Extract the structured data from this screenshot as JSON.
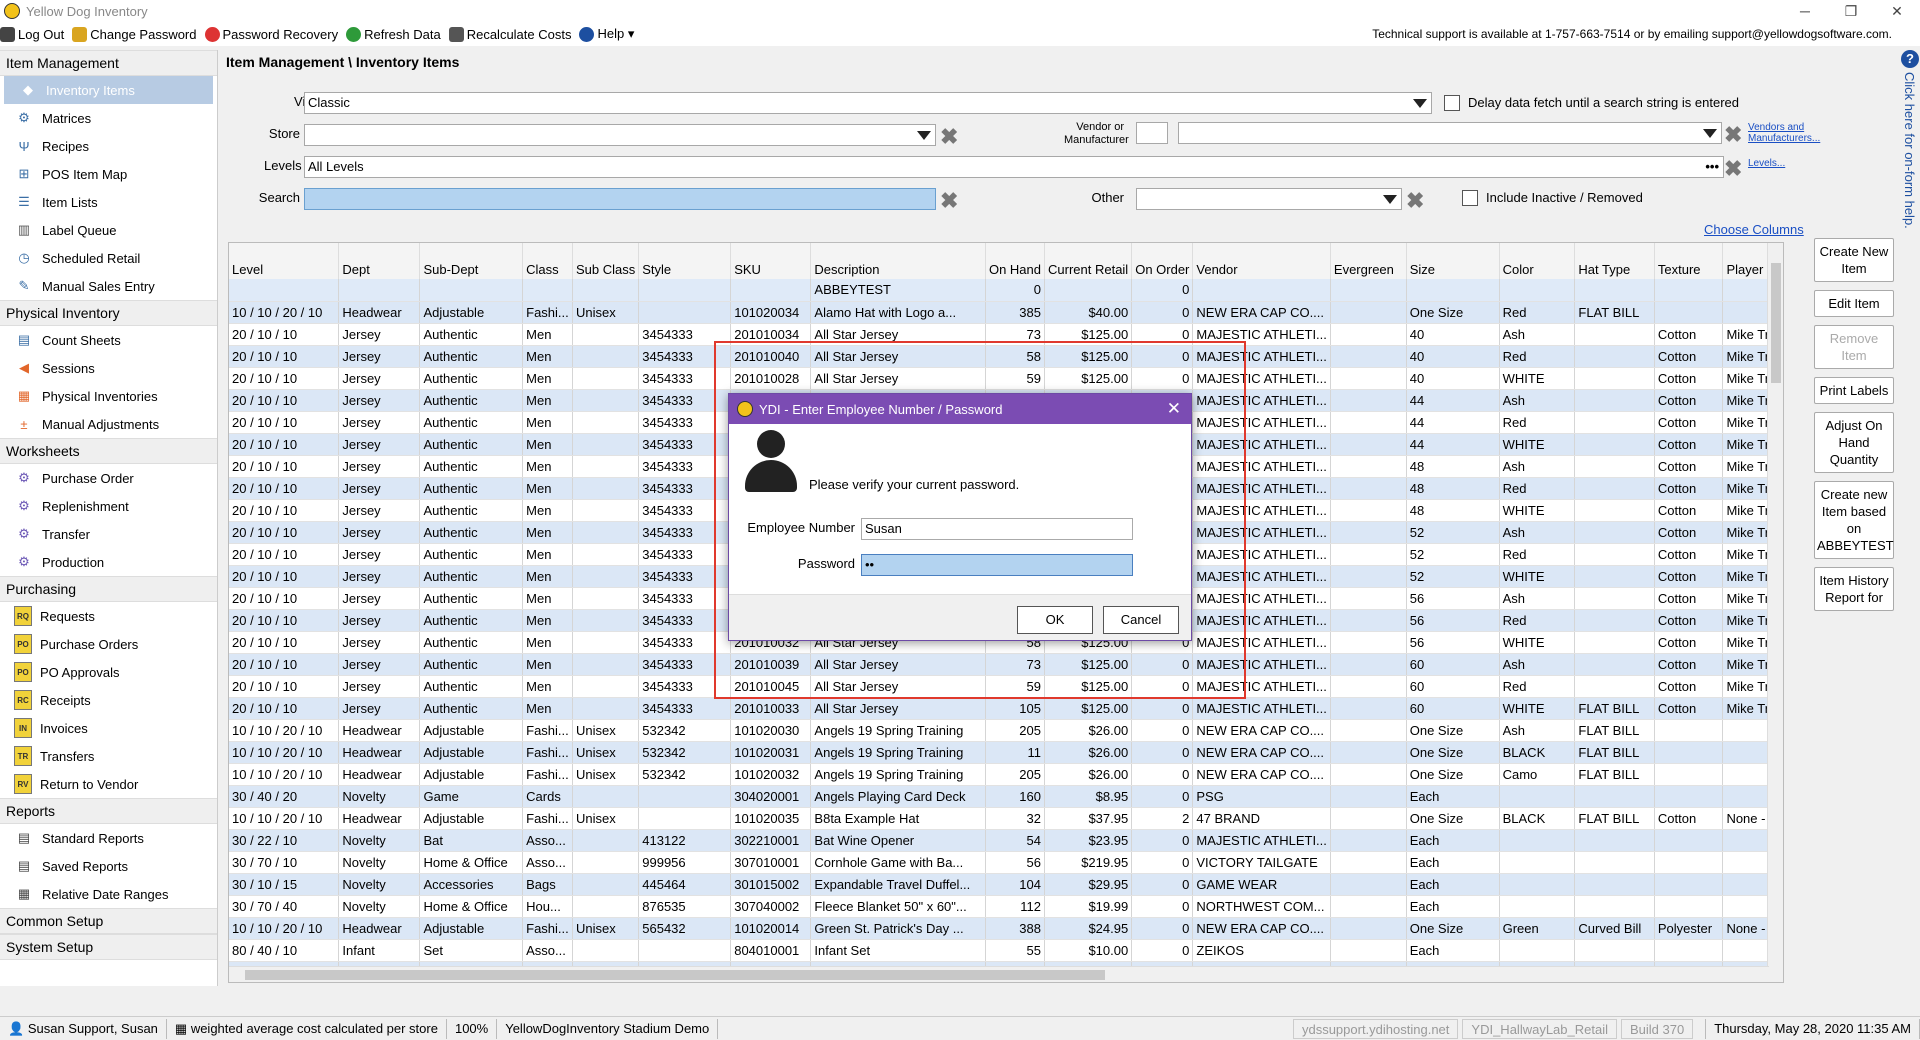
{
  "window": {
    "title": "Yellow Dog Inventory"
  },
  "menubar": {
    "items": [
      "Log Out",
      "Change Password",
      "Password Recovery",
      "Refresh Data",
      "Recalculate Costs",
      "Help ▾"
    ],
    "support": "Technical support is available at 1-757-663-7514 or by emailing support@yellowdogsoftware.com."
  },
  "sidebar": {
    "sections": [
      {
        "label": "Item Management",
        "items": [
          "Inventory Items",
          "Matrices",
          "Recipes",
          "POS Item Map",
          "Item Lists",
          "Label Queue",
          "Scheduled Retail",
          "Manual Sales Entry"
        ]
      },
      {
        "label": "Physical Inventory",
        "items": [
          "Count Sheets",
          "Sessions",
          "Physical Inventories",
          "Manual Adjustments"
        ]
      },
      {
        "label": "Worksheets",
        "items": [
          "Purchase Order",
          "Replenishment",
          "Transfer",
          "Production"
        ]
      },
      {
        "label": "Purchasing",
        "items": [
          "Requests",
          "Purchase Orders",
          "PO Approvals",
          "Receipts",
          "Invoices",
          "Transfers",
          "Return to Vendor"
        ]
      },
      {
        "label": "Reports",
        "items": [
          "Standard Reports",
          "Saved Reports",
          "Relative Date Ranges"
        ]
      },
      {
        "label": "Common Setup",
        "items": []
      },
      {
        "label": "System Setup",
        "items": []
      }
    ],
    "doc_badges": [
      "RQ",
      "PO",
      "PO",
      "RC",
      "IN",
      "TR",
      "RV"
    ]
  },
  "breadcrumb": "Item Management \\ Inventory Items",
  "filters": {
    "view_label": "View",
    "view_value": "Classic",
    "delay_label": "Delay data fetch until a search string is entered",
    "store_label": "Store",
    "store_value": "",
    "vendor_label": "Vendor or Manufacturer",
    "vendors_link": "Vendors and Manufacturers...",
    "levels_label": "Levels",
    "levels_value": "All Levels",
    "levels_dots": "•••",
    "levels_link": "Levels...",
    "search_label": "Search",
    "search_value": "",
    "other_label": "Other",
    "include_inactive_label": "Include Inactive / Removed"
  },
  "choose_columns": "Choose Columns",
  "grid": {
    "columns": [
      "Level",
      "Dept",
      "Sub-Dept",
      "Class",
      "Sub Class",
      "Style",
      "SKU",
      "Description",
      "On Hand",
      "Current Retail",
      "On Order",
      "Vendor",
      "Evergreen",
      "Size",
      "Color",
      "Hat Type",
      "Texture",
      "Player"
    ],
    "rows": [
      [
        "",
        "",
        "",
        "",
        "",
        "",
        "",
        "ABBEYTEST",
        "0",
        "",
        "0",
        "",
        "",
        "",
        "",
        "",
        "",
        ""
      ],
      [
        "10 / 10 / 20 / 10",
        "Headwear",
        "Adjustable",
        "Fashi...",
        "Unisex",
        "",
        "101020034",
        "Alamo Hat with Logo a...",
        "385",
        "$40.00",
        "0",
        "NEW ERA CAP CO....",
        "",
        "One Size",
        "Red",
        "FLAT BILL",
        "",
        ""
      ],
      [
        "20 / 10 / 10",
        "Jersey",
        "Authentic",
        "Men",
        "",
        "3454333",
        "201010034",
        "All Star Jersey",
        "73",
        "$125.00",
        "0",
        "MAJESTIC ATHLETI...",
        "",
        "40",
        "Ash",
        "",
        "Cotton",
        "Mike Tro"
      ],
      [
        "20 / 10 / 10",
        "Jersey",
        "Authentic",
        "Men",
        "",
        "3454333",
        "201010040",
        "All Star Jersey",
        "58",
        "$125.00",
        "0",
        "MAJESTIC ATHLETI...",
        "",
        "40",
        "Red",
        "",
        "Cotton",
        "Mike Tro"
      ],
      [
        "20 / 10 / 10",
        "Jersey",
        "Authentic",
        "Men",
        "",
        "3454333",
        "201010028",
        "All Star Jersey",
        "59",
        "$125.00",
        "0",
        "MAJESTIC ATHLETI...",
        "",
        "40",
        "WHITE",
        "",
        "Cotton",
        "Mike Tro"
      ],
      [
        "20 / 10 / 10",
        "Jersey",
        "Authentic",
        "Men",
        "",
        "3454333",
        "",
        "",
        "",
        "",
        "",
        "MAJESTIC ATHLETI...",
        "",
        "44",
        "Ash",
        "",
        "Cotton",
        "Mike Tro"
      ],
      [
        "20 / 10 / 10",
        "Jersey",
        "Authentic",
        "Men",
        "",
        "3454333",
        "",
        "",
        "",
        "",
        "",
        "MAJESTIC ATHLETI...",
        "",
        "44",
        "Red",
        "",
        "Cotton",
        "Mike Tro"
      ],
      [
        "20 / 10 / 10",
        "Jersey",
        "Authentic",
        "Men",
        "",
        "3454333",
        "",
        "",
        "",
        "",
        "",
        "MAJESTIC ATHLETI...",
        "",
        "44",
        "WHITE",
        "",
        "Cotton",
        "Mike Tro"
      ],
      [
        "20 / 10 / 10",
        "Jersey",
        "Authentic",
        "Men",
        "",
        "3454333",
        "",
        "",
        "",
        "",
        "",
        "MAJESTIC ATHLETI...",
        "",
        "48",
        "Ash",
        "",
        "Cotton",
        "Mike Tro"
      ],
      [
        "20 / 10 / 10",
        "Jersey",
        "Authentic",
        "Men",
        "",
        "3454333",
        "",
        "",
        "",
        "",
        "",
        "MAJESTIC ATHLETI...",
        "",
        "48",
        "Red",
        "",
        "Cotton",
        "Mike Tro"
      ],
      [
        "20 / 10 / 10",
        "Jersey",
        "Authentic",
        "Men",
        "",
        "3454333",
        "",
        "",
        "",
        "",
        "",
        "MAJESTIC ATHLETI...",
        "",
        "48",
        "WHITE",
        "",
        "Cotton",
        "Mike Tro"
      ],
      [
        "20 / 10 / 10",
        "Jersey",
        "Authentic",
        "Men",
        "",
        "3454333",
        "",
        "",
        "",
        "",
        "",
        "MAJESTIC ATHLETI...",
        "",
        "52",
        "Ash",
        "",
        "Cotton",
        "Mike Tro"
      ],
      [
        "20 / 10 / 10",
        "Jersey",
        "Authentic",
        "Men",
        "",
        "3454333",
        "",
        "",
        "",
        "",
        "",
        "MAJESTIC ATHLETI...",
        "",
        "52",
        "Red",
        "",
        "Cotton",
        "Mike Tro"
      ],
      [
        "20 / 10 / 10",
        "Jersey",
        "Authentic",
        "Men",
        "",
        "3454333",
        "",
        "",
        "",
        "",
        "",
        "MAJESTIC ATHLETI...",
        "",
        "52",
        "WHITE",
        "",
        "Cotton",
        "Mike Tro"
      ],
      [
        "20 / 10 / 10",
        "Jersey",
        "Authentic",
        "Men",
        "",
        "3454333",
        "",
        "",
        "",
        "",
        "",
        "MAJESTIC ATHLETI...",
        "",
        "56",
        "Ash",
        "",
        "Cotton",
        "Mike Tro"
      ],
      [
        "20 / 10 / 10",
        "Jersey",
        "Authentic",
        "Men",
        "",
        "3454333",
        "",
        "",
        "",
        "",
        "",
        "MAJESTIC ATHLETI...",
        "",
        "56",
        "Red",
        "",
        "Cotton",
        "Mike Tro"
      ],
      [
        "20 / 10 / 10",
        "Jersey",
        "Authentic",
        "Men",
        "",
        "3454333",
        "201010032",
        "All Star Jersey",
        "58",
        "$125.00",
        "0",
        "MAJESTIC ATHLETI...",
        "",
        "56",
        "WHITE",
        "",
        "Cotton",
        "Mike Tro"
      ],
      [
        "20 / 10 / 10",
        "Jersey",
        "Authentic",
        "Men",
        "",
        "3454333",
        "201010039",
        "All Star Jersey",
        "73",
        "$125.00",
        "0",
        "MAJESTIC ATHLETI...",
        "",
        "60",
        "Ash",
        "",
        "Cotton",
        "Mike Tro"
      ],
      [
        "20 / 10 / 10",
        "Jersey",
        "Authentic",
        "Men",
        "",
        "3454333",
        "201010045",
        "All Star Jersey",
        "59",
        "$125.00",
        "0",
        "MAJESTIC ATHLETI...",
        "",
        "60",
        "Red",
        "",
        "Cotton",
        "Mike Tro"
      ],
      [
        "20 / 10 / 10",
        "Jersey",
        "Authentic",
        "Men",
        "",
        "3454333",
        "201010033",
        "All Star Jersey",
        "105",
        "$125.00",
        "0",
        "MAJESTIC ATHLETI...",
        "",
        "60",
        "WHITE",
        "FLAT BILL",
        "Cotton",
        "Mike Tro"
      ],
      [
        "10 / 10 / 20 / 10",
        "Headwear",
        "Adjustable",
        "Fashi...",
        "Unisex",
        "532342",
        "101020030",
        "Angels 19 Spring Training",
        "205",
        "$26.00",
        "0",
        "NEW ERA CAP CO....",
        "",
        "One Size",
        "Ash",
        "FLAT BILL",
        "",
        ""
      ],
      [
        "10 / 10 / 20 / 10",
        "Headwear",
        "Adjustable",
        "Fashi...",
        "Unisex",
        "532342",
        "101020031",
        "Angels 19 Spring Training",
        "11",
        "$26.00",
        "0",
        "NEW ERA CAP CO....",
        "",
        "One Size",
        "BLACK",
        "FLAT BILL",
        "",
        ""
      ],
      [
        "10 / 10 / 20 / 10",
        "Headwear",
        "Adjustable",
        "Fashi...",
        "Unisex",
        "532342",
        "101020032",
        "Angels 19 Spring Training",
        "205",
        "$26.00",
        "0",
        "NEW ERA CAP CO....",
        "",
        "One Size",
        "Camo",
        "FLAT BILL",
        "",
        ""
      ],
      [
        "30 / 40 / 20",
        "Novelty",
        "Game",
        "Cards",
        "",
        "",
        "304020001",
        "Angels Playing Card Deck",
        "160",
        "$8.95",
        "0",
        "PSG",
        "",
        "Each",
        "",
        "",
        "",
        ""
      ],
      [
        "10 / 10 / 20 / 10",
        "Headwear",
        "Adjustable",
        "Fashi...",
        "Unisex",
        "",
        "101020035",
        "B8ta Example Hat",
        "32",
        "$37.95",
        "2",
        "47 BRAND",
        "",
        "One Size",
        "BLACK",
        "FLAT BILL",
        "Cotton",
        "None - B"
      ],
      [
        "30 / 22 / 10",
        "Novelty",
        "Bat",
        "Asso...",
        "",
        "413122",
        "302210001",
        "Bat Wine Opener",
        "54",
        "$23.95",
        "0",
        "MAJESTIC ATHLETI...",
        "",
        "Each",
        "",
        "",
        "",
        ""
      ],
      [
        "30 / 70 / 10",
        "Novelty",
        "Home & Office",
        "Asso...",
        "",
        "999956",
        "307010001",
        "Cornhole Game with Ba...",
        "56",
        "$219.95",
        "0",
        "VICTORY TAILGATE",
        "",
        "Each",
        "",
        "",
        "",
        ""
      ],
      [
        "30 / 10 / 15",
        "Novelty",
        "Accessories",
        "Bags",
        "",
        "445464",
        "301015002",
        "Expandable Travel Duffel...",
        "104",
        "$29.95",
        "0",
        "GAME WEAR",
        "",
        "Each",
        "",
        "",
        "",
        ""
      ],
      [
        "30 / 70 / 40",
        "Novelty",
        "Home & Office",
        "Hou...",
        "",
        "876535",
        "307040002",
        "Fleece Blanket 50\" x 60\"...",
        "112",
        "$19.99",
        "0",
        "NORTHWEST COM...",
        "",
        "Each",
        "",
        "",
        "",
        ""
      ],
      [
        "10 / 10 / 20 / 10",
        "Headwear",
        "Adjustable",
        "Fashi...",
        "Unisex",
        "565432",
        "101020014",
        "Green St. Patrick's Day ...",
        "388",
        "$24.95",
        "0",
        "NEW ERA CAP CO....",
        "",
        "One Size",
        "Green",
        "Curved Bill",
        "Polyester",
        "None - B"
      ],
      [
        "80 / 40 / 10",
        "Infant",
        "Set",
        "Asso...",
        "",
        "",
        "804010001",
        "Infant Set",
        "55",
        "$10.00",
        "0",
        "ZEIKOS",
        "",
        "Each",
        "",
        "",
        "",
        ""
      ],
      [
        "80 / 40 / 10",
        "Infant",
        "Set",
        "Asso...",
        "",
        "",
        "804010004",
        "Infant Set Classic Logo",
        "0",
        "$10.00",
        "0",
        "ZEIKOS",
        "",
        "Each",
        "",
        "",
        "",
        ""
      ]
    ]
  },
  "actions": [
    "Create New Item",
    "Edit Item",
    "Remove Item",
    "Print Labels",
    "Adjust On Hand Quantity",
    "Create new Item based on ABBEYTEST",
    "Item History Report for"
  ],
  "help": {
    "glyph": "?",
    "text": "Click here for on-form help."
  },
  "status": {
    "user": "Susan Support, Susan",
    "costing": "weighted average cost calculated per store",
    "zoom": "100%",
    "db": "YellowDogInventory Stadium Demo",
    "host": "ydssupport.ydihosting.net",
    "store": "YDI_HallwayLab_Retail",
    "build": "Build 370",
    "datetime": "Thursday, May 28, 2020 11:35 AM"
  },
  "dialog": {
    "title": "YDI - Enter Employee Number / Password",
    "message": "Please verify your current password.",
    "employee_label": "Employee Number",
    "employee_value": "Susan",
    "password_label": "Password",
    "password_value": "••",
    "ok": "OK",
    "cancel": "Cancel"
  },
  "colors": {
    "dialog_title": "#7b4cb3",
    "row_alt": "#dbe7f6",
    "highlight": "#e0392d",
    "link": "#1a4fc4"
  }
}
